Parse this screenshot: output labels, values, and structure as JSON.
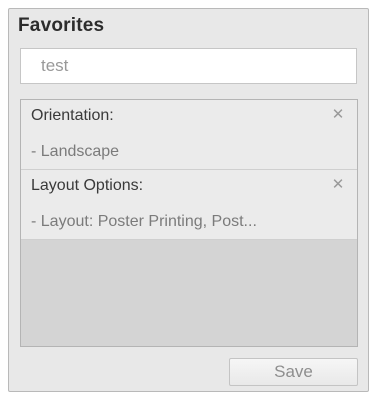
{
  "favorites": {
    "title": "Favorites",
    "name_input_value": "test",
    "settings": [
      {
        "label": "Orientation:",
        "value": "- Landscape",
        "remove_icon": "close-icon"
      },
      {
        "label": "Layout Options:",
        "value": "- Layout: Poster Printing, Post...",
        "remove_icon": "close-icon"
      }
    ],
    "save_label": "Save",
    "colors": {
      "panel_background": "#e8e8e8",
      "list_background": "#d4d4d4",
      "item_background": "#ebebeb"
    }
  }
}
